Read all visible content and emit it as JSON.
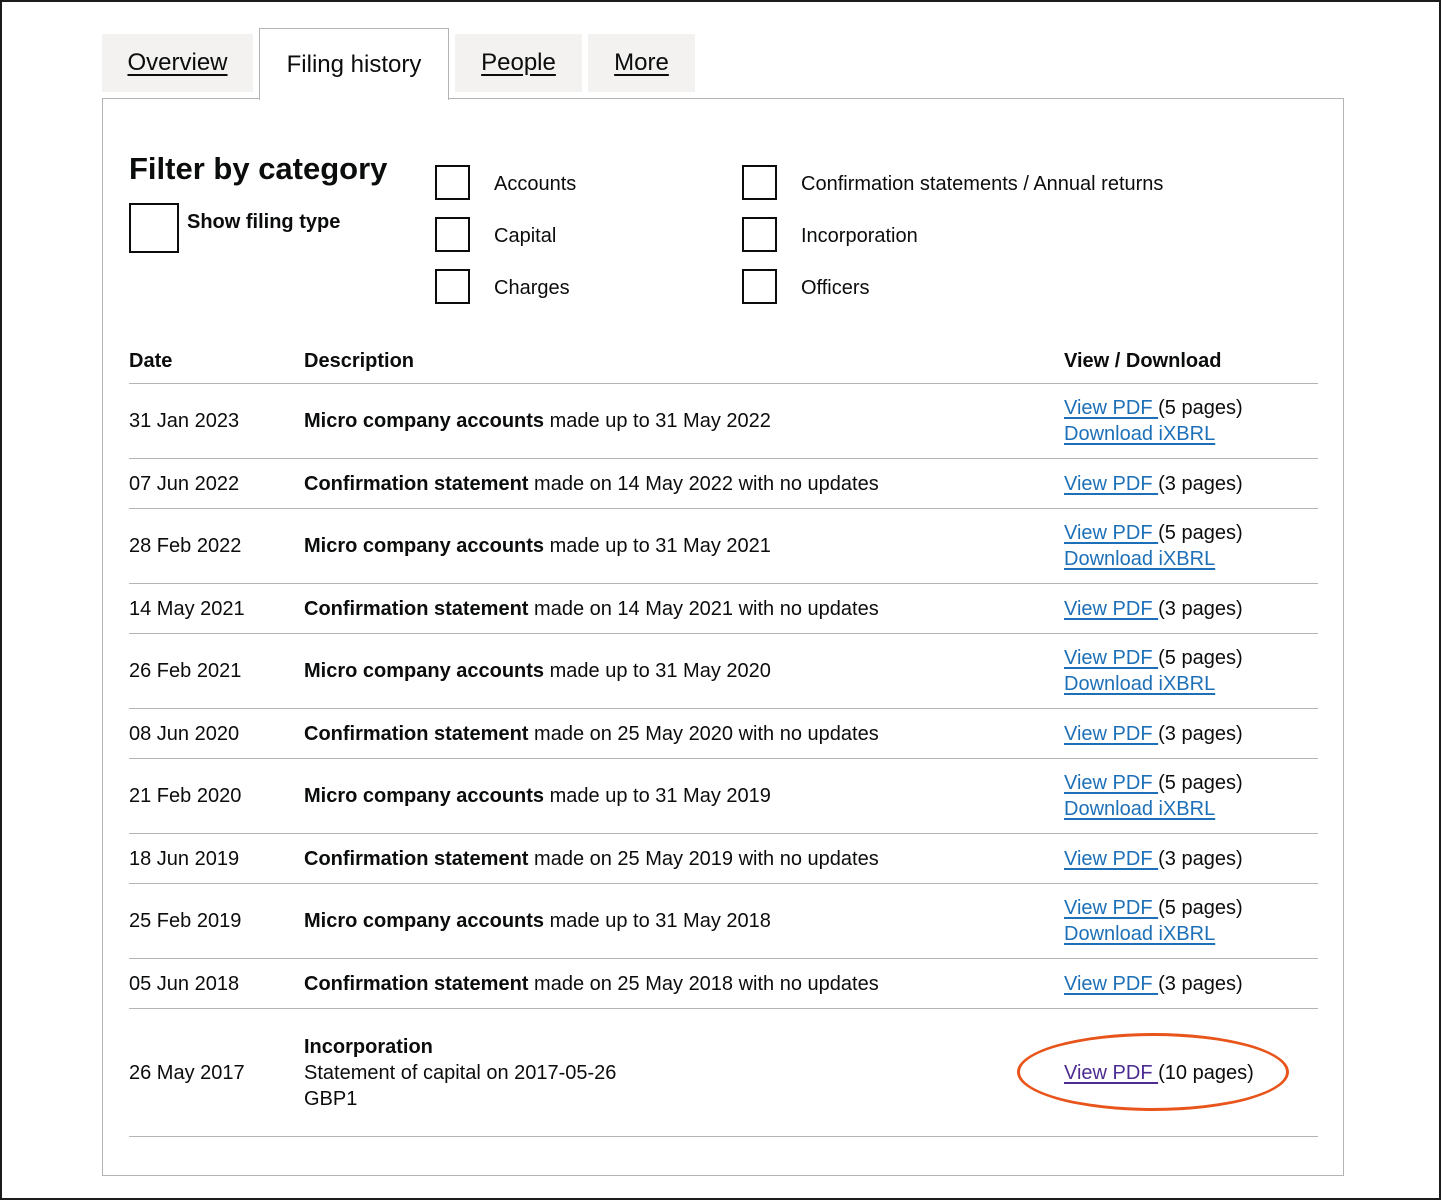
{
  "tabs": [
    {
      "label": "Overview",
      "active": false
    },
    {
      "label": "Filing history",
      "active": true
    },
    {
      "label": "People",
      "active": false
    },
    {
      "label": "More",
      "active": false
    }
  ],
  "filter": {
    "title": "Filter by category",
    "show_filing_type": "Show filing type",
    "categories": [
      "Accounts",
      "Capital",
      "Charges",
      "Confirmation statements / Annual returns",
      "Incorporation",
      "Officers"
    ]
  },
  "table": {
    "headers": {
      "date": "Date",
      "description": "Description",
      "view": "View / Download"
    },
    "rows": [
      {
        "date": "31 Jan 2023",
        "bold": "Micro company accounts",
        "rest": "made up to 31 May 2022",
        "pdf": "View PDF ",
        "pages": "(5 pages)",
        "ixbrl": "Download iXBRL"
      },
      {
        "date": "07 Jun 2022",
        "bold": "Confirmation statement",
        "rest": "made on 14 May 2022 with no updates",
        "pdf": "View PDF ",
        "pages": "(3 pages)"
      },
      {
        "date": "28 Feb 2022",
        "bold": "Micro company accounts",
        "rest": "made up to 31 May 2021",
        "pdf": "View PDF ",
        "pages": "(5 pages)",
        "ixbrl": "Download iXBRL"
      },
      {
        "date": "14 May 2021",
        "bold": "Confirmation statement",
        "rest": "made on 14 May 2021 with no updates",
        "pdf": "View PDF ",
        "pages": "(3 pages)"
      },
      {
        "date": "26 Feb 2021",
        "bold": "Micro company accounts",
        "rest": "made up to 31 May 2020",
        "pdf": "View PDF ",
        "pages": "(5 pages)",
        "ixbrl": "Download iXBRL"
      },
      {
        "date": "08 Jun 2020",
        "bold": "Confirmation statement",
        "rest": "made on 25 May 2020 with no updates",
        "pdf": "View PDF ",
        "pages": "(3 pages)"
      },
      {
        "date": "21 Feb 2020",
        "bold": "Micro company accounts",
        "rest": "made up to 31 May 2019",
        "pdf": "View PDF ",
        "pages": "(5 pages)",
        "ixbrl": "Download iXBRL"
      },
      {
        "date": "18 Jun 2019",
        "bold": "Confirmation statement",
        "rest": "made on 25 May 2019 with no updates",
        "pdf": "View PDF ",
        "pages": "(3 pages)"
      },
      {
        "date": "25 Feb 2019",
        "bold": "Micro company accounts",
        "rest": "made up to 31 May 2018",
        "pdf": "View PDF ",
        "pages": "(5 pages)",
        "ixbrl": "Download iXBRL"
      },
      {
        "date": "05 Jun 2018",
        "bold": "Confirmation statement",
        "rest": "made on 25 May 2018 with no updates",
        "pdf": "View PDF ",
        "pages": "(3 pages)"
      }
    ],
    "last": {
      "date": "26 May 2017",
      "title": "Incorporation",
      "line2": "Statement of capital on 2017-05-26",
      "line3": "GBP1",
      "pdf": "View PDF ",
      "pages": "(10 pages)"
    }
  },
  "colors": {
    "link": "#1d70b8",
    "visited": "#4c2c92",
    "highlight": "#e8541a"
  }
}
